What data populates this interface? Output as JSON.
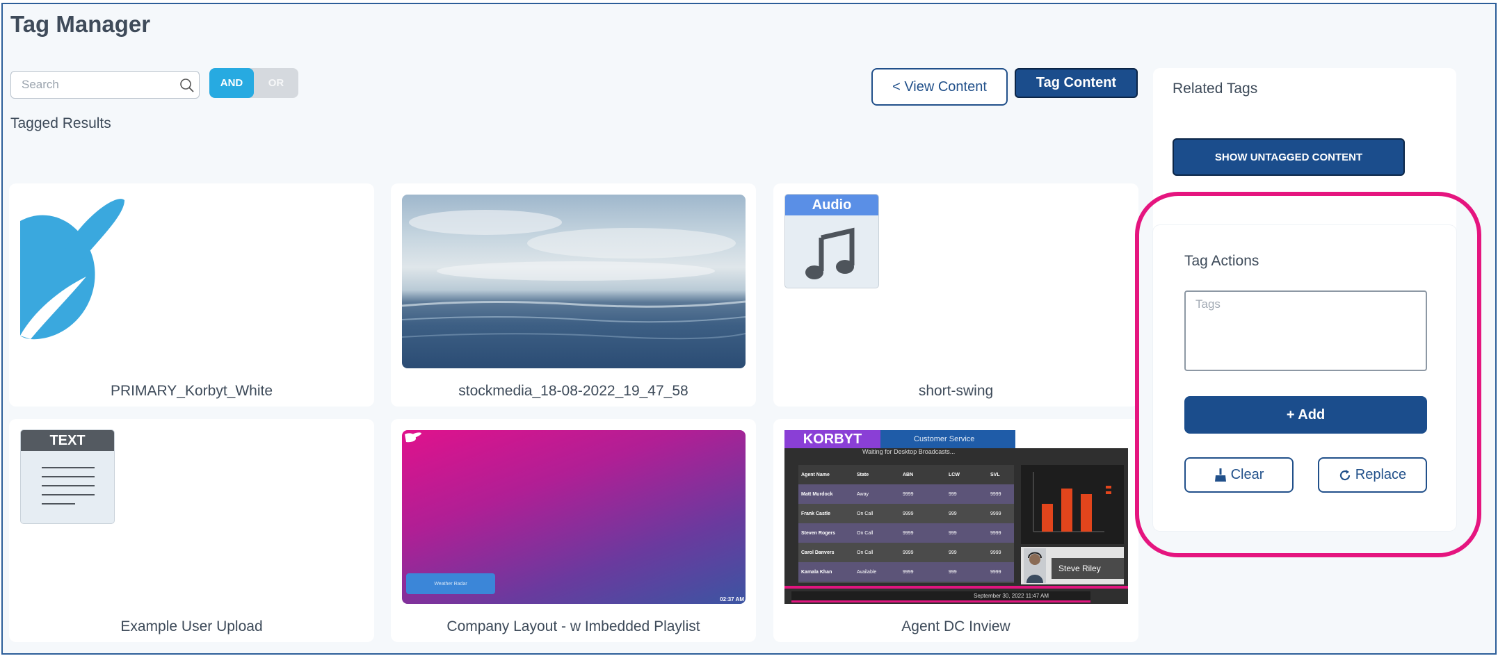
{
  "page": {
    "title": "Tag Manager",
    "section_label": "Tagged Results"
  },
  "search": {
    "placeholder": "Search"
  },
  "toggle": {
    "and_label": "AND",
    "or_label": "OR",
    "selected": "AND"
  },
  "top_buttons": {
    "view_content": "< View Content",
    "tag_content": "Tag Content"
  },
  "cards": [
    {
      "name": "PRIMARY_Korbyt_White",
      "kind": "logo"
    },
    {
      "name": "stockmedia_18-08-2022_19_47_58",
      "kind": "image"
    },
    {
      "name": "short-swing",
      "kind": "audio",
      "badge": "Audio"
    },
    {
      "name": "Example User Upload",
      "kind": "text",
      "badge": "TEXT"
    },
    {
      "name": "Company Layout - w Imbedded Playlist",
      "kind": "layout",
      "inner_button": "Weather Radar",
      "time": "02:37 AM"
    },
    {
      "name": "Agent DC Inview",
      "kind": "dashboard",
      "brand": "KORBYT",
      "header": "Customer Service",
      "subheader": "Waiting for Desktop Broadcasts...",
      "table_headers": [
        "Agent Name",
        "State",
        "ABN",
        "LCW",
        "SVL"
      ],
      "table_rows": [
        [
          "Matt Murdock",
          "Away",
          "9999",
          "999",
          "9999"
        ],
        [
          "Frank Castle",
          "On Call",
          "9999",
          "999",
          "9999"
        ],
        [
          "Steven Rogers",
          "On Call",
          "9999",
          "999",
          "9999"
        ],
        [
          "Carol Danvers",
          "On Call",
          "9999",
          "999",
          "9999"
        ],
        [
          "Kamala Khan",
          "Available",
          "9999",
          "999",
          "9999"
        ]
      ],
      "agent_name": "Steve Riley",
      "footer_time": "September 30, 2022 11:47 AM"
    }
  ],
  "sidebar": {
    "related_title": "Related Tags",
    "untagged_button": "SHOW UNTAGGED CONTENT",
    "tag_actions_title": "Tag Actions",
    "tags_placeholder": "Tags",
    "add_button": "+ Add",
    "clear_button": "Clear",
    "replace_button": "Replace"
  },
  "colors": {
    "primary": "#1b4d8c",
    "accent": "#27aae1",
    "highlight": "#e5157f",
    "audio": "#5a8fe6"
  }
}
